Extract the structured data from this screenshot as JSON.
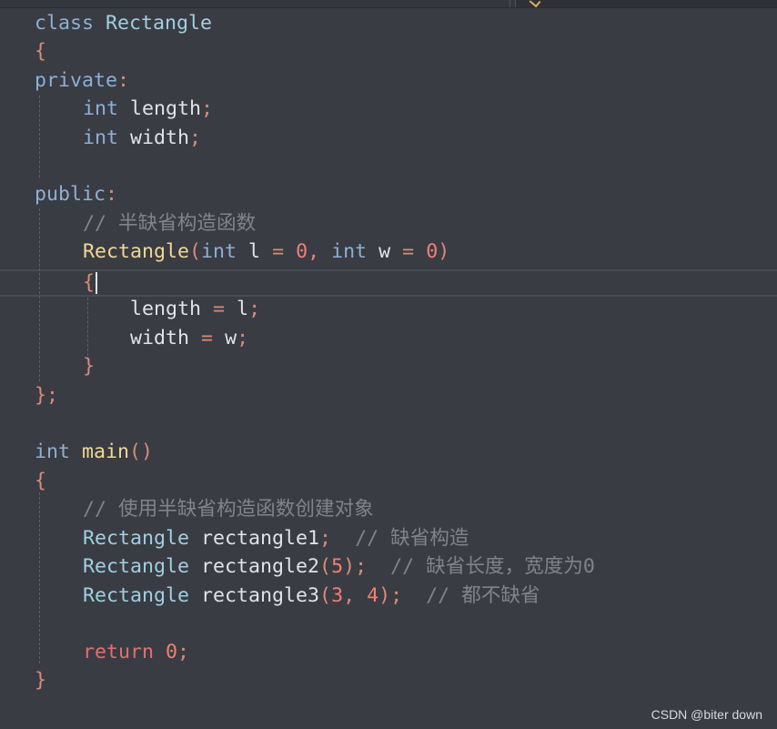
{
  "editor": {
    "lines": {
      "l1_kw": "class",
      "l1_name": "Rectangle",
      "l2": "{",
      "l3_kw": "private",
      "l3_colon": ":",
      "l4_type": "int",
      "l4_name": "length",
      "l4_semi": ";",
      "l5_type": "int",
      "l5_name": "width",
      "l5_semi": ";",
      "l7_kw": "public",
      "l7_colon": ":",
      "l8_comment": "// 半缺省构造函数",
      "l9_fn": "Rectangle",
      "l9_p1": "(",
      "l9_t1": "int",
      "l9_a1": " l ",
      "l9_eq1": "=",
      "l9_v1": "0",
      "l9_comma": ",",
      "l9_t2": "int",
      "l9_a2": " w ",
      "l9_eq2": "=",
      "l9_v2": "0",
      "l9_p2": ")",
      "l10": "{",
      "l11_name": "length",
      "l11_eq": "=",
      "l11_val": "l",
      "l11_semi": ";",
      "l12_name": "width",
      "l12_eq": "=",
      "l12_val": "w",
      "l12_semi": ";",
      "l13": "}",
      "l14": "};",
      "l16_type": "int",
      "l16_fn": "main",
      "l16_parens": "()",
      "l17": "{",
      "l18_comment": "// 使用半缺省构造函数创建对象",
      "l19_cls": "Rectangle",
      "l19_var": "rectangle1",
      "l19_semi": ";",
      "l19_comment": "// 缺省构造",
      "l20_cls": "Rectangle",
      "l20_var": "rectangle2",
      "l20_p1": "(",
      "l20_v": "5",
      "l20_p2": ")",
      "l20_semi": ";",
      "l20_comment": "// 缺省长度，宽度为0",
      "l21_cls": "Rectangle",
      "l21_var": "rectangle3",
      "l21_p1": "(",
      "l21_v1": "3",
      "l21_comma": ", ",
      "l21_v2": "4",
      "l21_p2": ")",
      "l21_semi": ";",
      "l21_comment": "// 都不缺省",
      "l23_kw": "return",
      "l23_v": "0",
      "l23_semi": ";",
      "l24": "}"
    }
  },
  "watermark": "CSDN @biter down",
  "colors": {
    "background": "#3a3c44",
    "keyword": "#8cb0d4",
    "class_name": "#9ed0e0",
    "function": "#f0d894",
    "number": "#f08070",
    "comment": "#80838c"
  }
}
